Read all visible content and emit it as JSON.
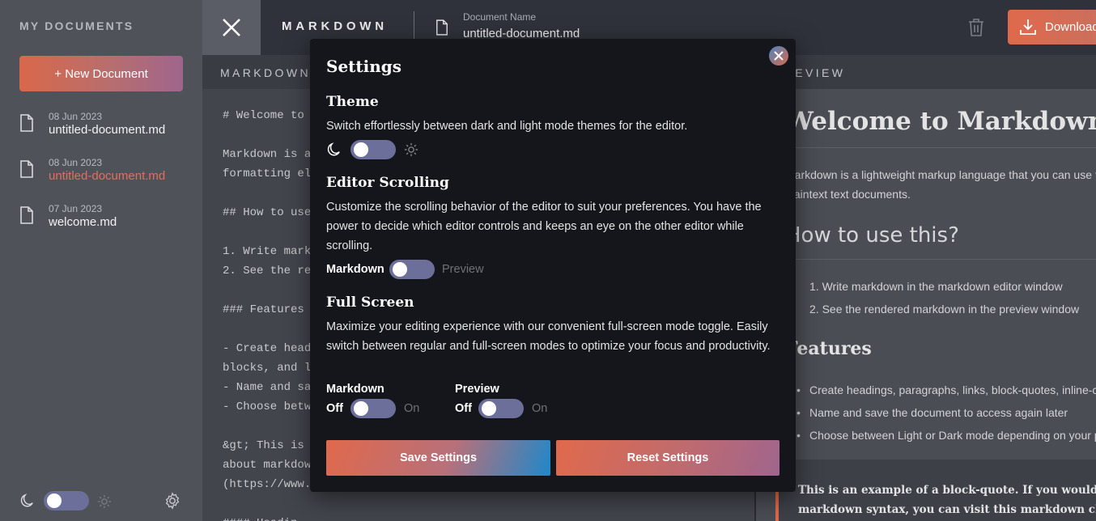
{
  "sidebar": {
    "title": "MY DOCUMENTS",
    "new_document": "+ New Document",
    "documents": [
      {
        "date": "08 Jun 2023",
        "name": "untitled-document.md"
      },
      {
        "date": "08 Jun 2023",
        "name": "untitled-document.md"
      },
      {
        "date": "07 Jun 2023",
        "name": "welcome.md"
      }
    ]
  },
  "topbar": {
    "brand": "MARKDOWN",
    "doc_name_label": "Document Name",
    "doc_name_value": "untitled-document.md",
    "download_label": "Download"
  },
  "editor": {
    "header": "MARKDOWN",
    "content": "# Welcome to\n\nMarkdown is a\nformatting el\n\n## How to use\n\n1. Write mark\n2. See the re\n\n### Features\n\n- Create head\nblocks, and l\n- Name and sa\n- Choose betw\n\n&gt; This is\nabout markdow\n(https://www.\n\n#### Headin"
  },
  "preview": {
    "header": "PREVIEW",
    "h1": "Welcome to Markdown",
    "p1_line1": "Markdown is a lightweight markup language that you can use to add formatting elements to",
    "p1_line2": "plaintext text documents.",
    "h2": "How to use this?",
    "ol": [
      "Write markdown in the markdown editor window",
      "See the rendered markdown in the preview window"
    ],
    "h3": "Features",
    "ul": [
      "Create headings, paragraphs, links, block-quotes, inline-code, code blocks, and lists",
      "Name and save the document to access again later",
      "Choose between Light or Dark mode depending on your preference"
    ],
    "quote_line1": "This is an example of a block-quote. If you would like to learn more about",
    "quote_line2": "markdown syntax, you can visit this markdown cheatsheet."
  },
  "settings": {
    "title": "Settings",
    "theme": {
      "title": "Theme",
      "desc": "Switch effortlessly between dark and light mode themes for the editor."
    },
    "scrolling": {
      "title": "Editor Scrolling",
      "desc": "Customize the scrolling behavior of the editor to suit your preferences. You have the power to decide which editor controls and keeps an eye on the other editor while scrolling.",
      "left_label": "Markdown",
      "right_label": "Preview"
    },
    "fullscreen": {
      "title": "Full Screen",
      "desc": "Maximize your editing experience with our convenient full-screen mode toggle. Easily switch between regular and full-screen modes to optimize your focus and productivity.",
      "markdown_label": "Markdown",
      "preview_label": "Preview",
      "off": "Off",
      "on": "On"
    },
    "save_button": "Save Settings",
    "reset_button": "Reset Settings"
  }
}
